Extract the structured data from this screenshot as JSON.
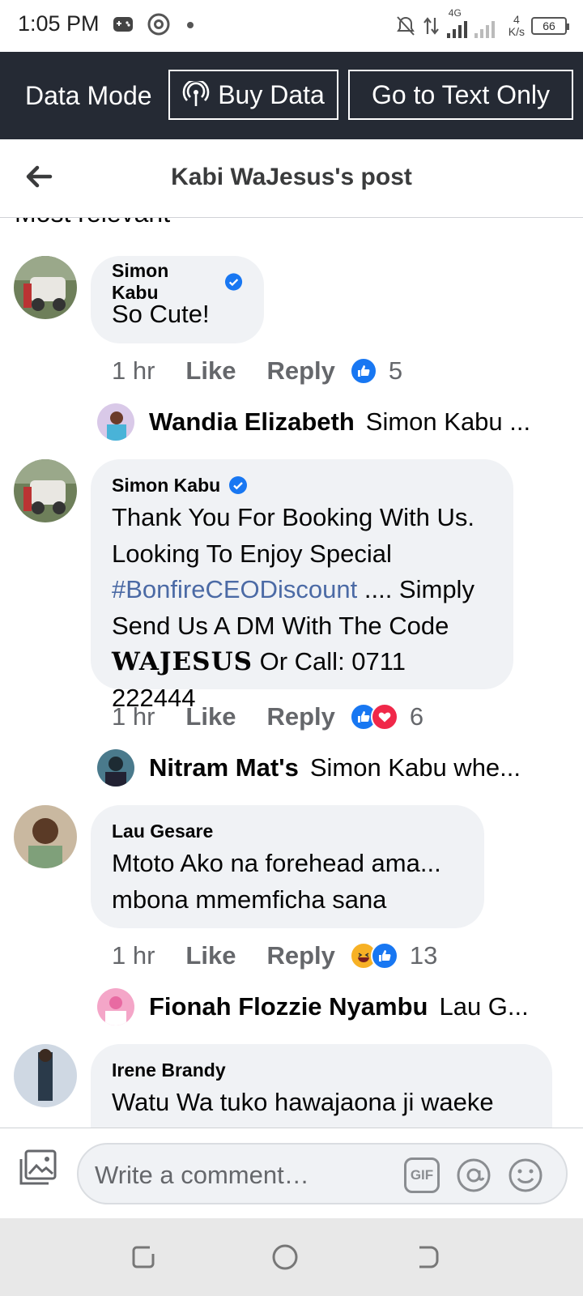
{
  "status_bar": {
    "time": "1:05 PM",
    "network": "4G",
    "speed_value": "4",
    "speed_unit": "K/s",
    "battery": "66"
  },
  "data_mode": {
    "label": "Data Mode",
    "buy_button": "Buy Data",
    "text_only_button": "Go to Text Only"
  },
  "header": {
    "title": "Kabi WaJesus's post",
    "sort_label": "Most relevant"
  },
  "comments": [
    {
      "author": "Simon Kabu",
      "verified": true,
      "text": "So Cute!",
      "time": "1 hr",
      "like_label": "Like",
      "reply_label": "Reply",
      "reactions": [
        "like-icon"
      ],
      "reaction_count": "5",
      "reply_preview": {
        "author": "Wandia Elizabeth",
        "snippet": "Simon Kabu ..."
      }
    },
    {
      "author": "Simon Kabu",
      "verified": true,
      "text_lines": {
        "l1": "Thank You For Booking With Us.",
        "l2": "Looking To Enjoy Special",
        "hashtag": "#BonfireCEODiscount",
        "l3_rest": " .... Simply",
        "l4": "Send Us A DM With The Code",
        "code": "WAJESUS",
        "l5_rest": " Or Call: 0711 222444"
      },
      "time": "1 hr",
      "like_label": "Like",
      "reply_label": "Reply",
      "reactions": [
        "like-icon",
        "love-icon"
      ],
      "reaction_count": "6",
      "reply_preview": {
        "author": "Nitram Mat's",
        "snippet": "Simon Kabu whe..."
      }
    },
    {
      "author": "Lau Gesare",
      "verified": false,
      "text_lines": {
        "l1": "Mtoto Ako na forehead ama...",
        "l2": "mbona mmemficha sana"
      },
      "time": "1 hr",
      "like_label": "Like",
      "reply_label": "Reply",
      "reactions": [
        "haha-icon",
        "like-icon"
      ],
      "reaction_count": "13",
      "reply_preview": {
        "author": "Fionah Flozzie Nyambu",
        "snippet": "Lau G..."
      }
    },
    {
      "author": "Irene Brandy",
      "verified": false,
      "text": "Watu Wa tuko hawajaona ji waeke"
    }
  ],
  "composer": {
    "placeholder": "Write a comment…",
    "gif_label": "GIF"
  },
  "colors": {
    "banner_bg": "#252a34",
    "bubble_bg": "#f0f2f5",
    "facebook_blue": "#1877f2",
    "hashtag": "#4b6aa5",
    "muted_text": "#65676b"
  }
}
